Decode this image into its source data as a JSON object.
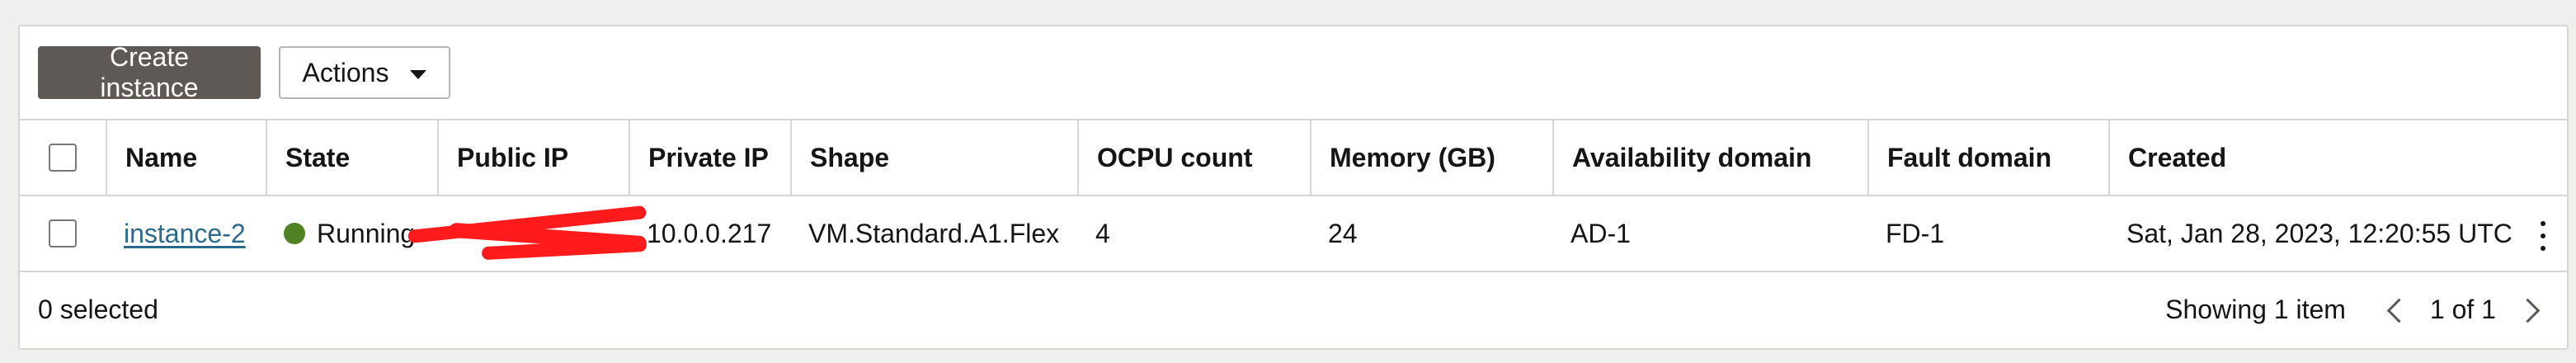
{
  "toolbar": {
    "create_label": "Create instance",
    "actions_label": "Actions"
  },
  "table": {
    "columns": [
      "Name",
      "State",
      "Public IP",
      "Private IP",
      "Shape",
      "OCPU count",
      "Memory (GB)",
      "Availability domain",
      "Fault domain",
      "Created"
    ],
    "rows": [
      {
        "name": "instance-2",
        "state": "Running",
        "public_ip": "",
        "private_ip": "10.0.0.217",
        "shape": "VM.Standard.A1.Flex",
        "ocpu": "4",
        "memory": "24",
        "ad": "AD-1",
        "fd": "FD-1",
        "created": "Sat, Jan 28, 2023, 12:20:55 UTC"
      }
    ]
  },
  "footer": {
    "selected_text": "0 selected",
    "showing_text": "Showing 1 item",
    "page_text": "1 of 1"
  },
  "colors": {
    "primary_button": "#5f5955",
    "running_status": "#508223",
    "link": "#2a6a8e",
    "redaction": "#ff1b1b"
  },
  "icons": [
    "caret-down-icon",
    "status-dot-icon",
    "kebab-menu-icon",
    "chevron-left-icon",
    "chevron-right-icon"
  ]
}
